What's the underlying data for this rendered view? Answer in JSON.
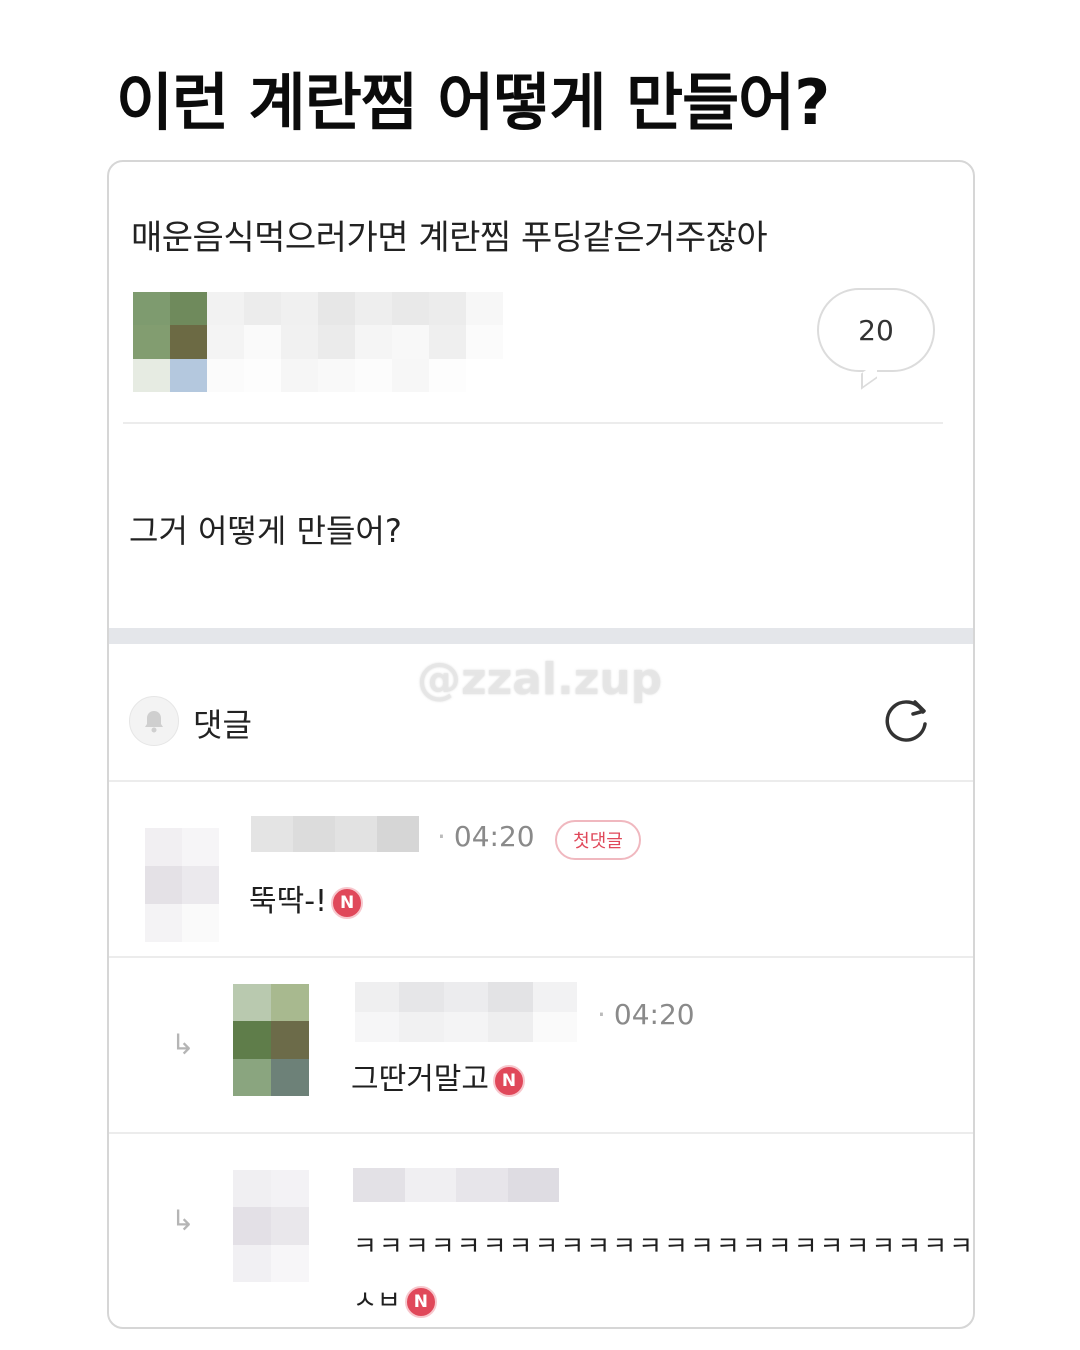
{
  "headline": "이런 계란찜 어떻게 만들어?",
  "post": {
    "title": "매운음식먹으러가면 계란찜 푸딩같은거주잖아",
    "comment_count": "20",
    "body": "그거 어떻게 만들어?"
  },
  "watermark": "@zzal.zup",
  "comments_section": {
    "label": "댓글"
  },
  "comments": [
    {
      "time": "04:20",
      "badge": "첫댓글",
      "text": "뚝딱-!",
      "new_mark": "N"
    },
    {
      "time": "04:20",
      "text": "그딴거말고",
      "new_mark": "N"
    },
    {
      "line1": "ㅋㅋㅋㅋㅋㅋㅋㅋㅋㅋㅋㅋㅋㅋㅋㅋㅋㅋㅋㅋㅋㅋㅋㅋㅋㅋㅋ",
      "line2": "ㅅㅂ",
      "new_mark": "N"
    }
  ],
  "icons": {
    "bell": "bell-icon",
    "refresh": "refresh-icon",
    "reply_arrow": "reply-arrow-icon",
    "comment_bubble": "comment-bubble-icon",
    "new_badge": "new-badge-icon"
  },
  "colors": {
    "accent_red": "#e0485a",
    "divider": "#e4e6ea"
  }
}
